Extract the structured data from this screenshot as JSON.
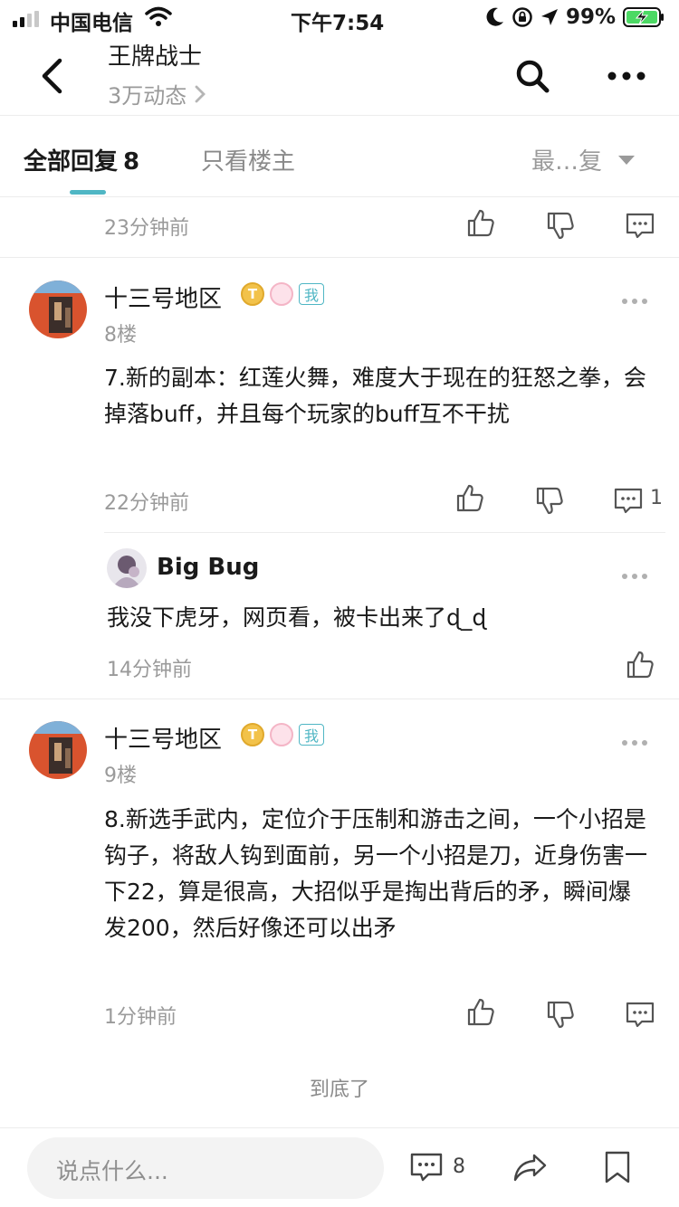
{
  "status": {
    "carrier": "中国电信",
    "time": "下午7:54",
    "battery": "99%"
  },
  "nav": {
    "title": "王牌战士",
    "subtitle": "3万动态",
    "icons": [
      "back-icon",
      "search-icon",
      "more-icon"
    ]
  },
  "tabs": {
    "all_label": "全部回复",
    "all_count": "8",
    "owner_label": "只看楼主",
    "sort_label": "最…复"
  },
  "top_partial": {
    "time": "23分钟前"
  },
  "post8": {
    "name": "十三号地区",
    "badge_t": "T",
    "badge_me": "我",
    "floor": "8楼",
    "text": "7.新的副本：红莲火舞，难度大于现在的狂怒之拳，会掉落buff，并且每个玩家的buff互不干扰",
    "time": "22分钟前",
    "reply_count": "1"
  },
  "reply": {
    "name": "Big Bug",
    "text": "我没下虎牙，网页看，被卡出来了ɖ_ɖ",
    "time": "14分钟前"
  },
  "post9": {
    "name": "十三号地区",
    "badge_t": "T",
    "badge_me": "我",
    "floor": "9楼",
    "text": "8.新选手武内，定位介于压制和游击之间，一个小招是钩子，将敌人钩到面前，另一个小招是刀，近身伤害一下22，算是很高，大招似乎是掏出背后的矛，瞬间爆发200，然后好像还可以出矛",
    "time": "1分钟前"
  },
  "end_text": "到底了",
  "bottom": {
    "placeholder": "说点什么...",
    "comment_count": "8"
  },
  "colors": {
    "accent": "#4fb6c4",
    "muted": "#9a9a9a"
  }
}
